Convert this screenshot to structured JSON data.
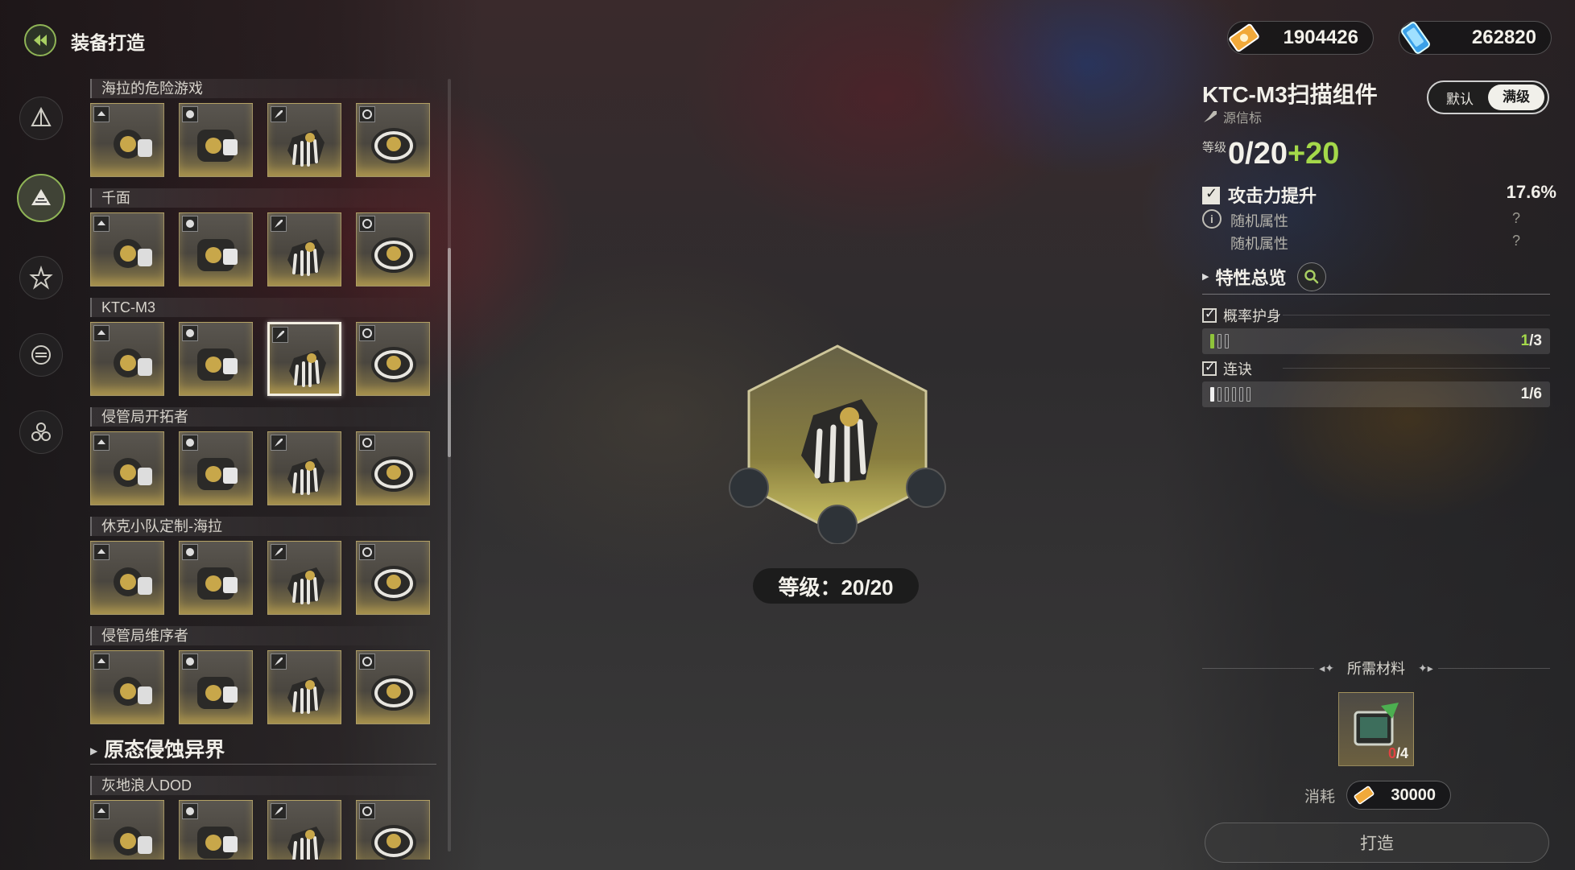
{
  "header": {
    "title": "装备打造"
  },
  "nav": [
    {
      "icon": "pyramid-icon"
    },
    {
      "icon": "mountain-icon",
      "active": true
    },
    {
      "icon": "star-icon"
    },
    {
      "icon": "disc-icon"
    },
    {
      "icon": "triad-icon"
    }
  ],
  "sets": [
    {
      "name": "海拉的危险游戏"
    },
    {
      "name": "千面"
    },
    {
      "name": "KTC-M3",
      "selected_index": 2
    },
    {
      "name": "侵管局开拓者"
    },
    {
      "name": "休克小队定制-海拉"
    },
    {
      "name": "侵管局维序者"
    }
  ],
  "section2": {
    "title": "原态侵蚀异界",
    "first_set": "灰地浪人DOD"
  },
  "center": {
    "level_text": "等级：20/20"
  },
  "currency": [
    {
      "icon": "gold-ticket-icon",
      "value": "1904426"
    },
    {
      "icon": "blue-crystal-icon",
      "value": "262820"
    }
  ],
  "detail": {
    "name": "KTC-M3扫描组件",
    "source": "源信标",
    "toggle": {
      "default": "默认",
      "max": "满级"
    },
    "level_label": "等级",
    "level_current": "0/20",
    "level_bonus": "+20",
    "main_attr": {
      "name": "攻击力提升",
      "value": "17.6%"
    },
    "random_attrs": [
      {
        "name": "随机属性",
        "value": "?"
      },
      {
        "name": "随机属性",
        "value": "?"
      }
    ],
    "trait_title": "特性总览",
    "traits": [
      {
        "name": "概率护身",
        "filled": 1,
        "total": 3,
        "cur": "1",
        "max": "/3",
        "color": "#8fc43a"
      },
      {
        "name": "连诀",
        "filled": 1,
        "total": 6,
        "cur": "1",
        "max": "/6",
        "color": "#f0f0f0"
      }
    ]
  },
  "materials": {
    "title": "所需材料",
    "item": {
      "icon": "monitor-material-icon",
      "owned": "0",
      "required": "/4"
    },
    "consume_label": "消耗",
    "consume_value": "30000",
    "craft_label": "打造"
  }
}
